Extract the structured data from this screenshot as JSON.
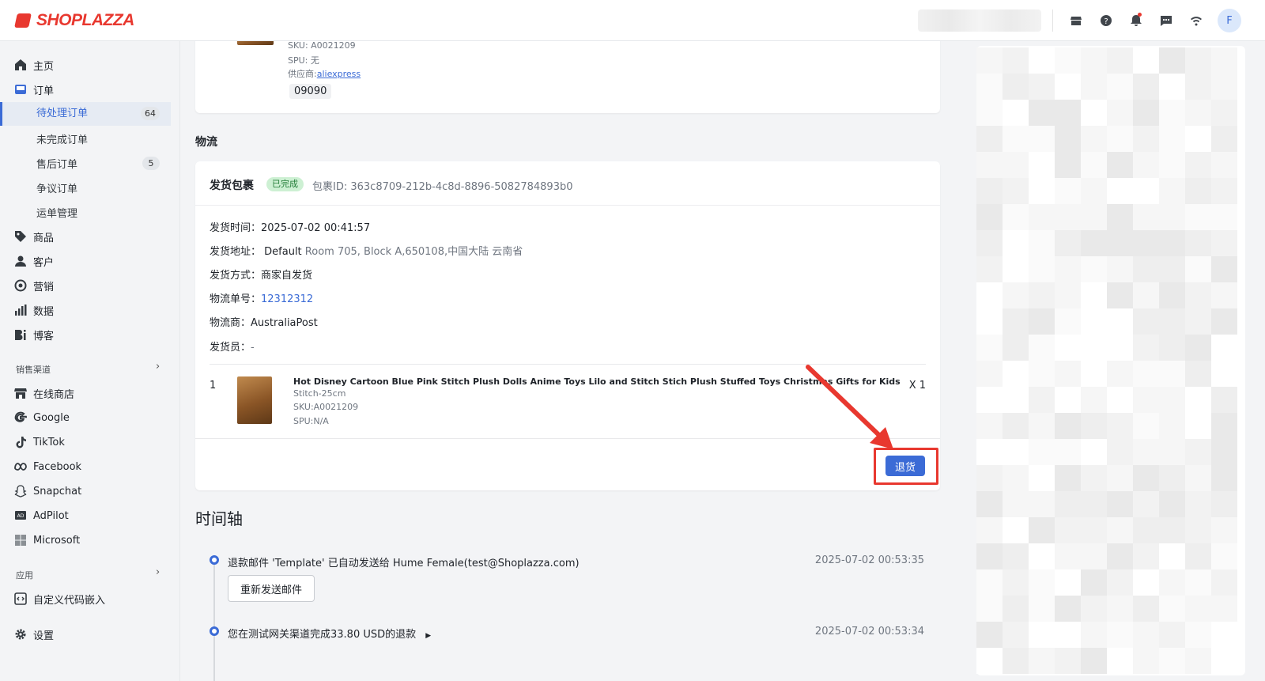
{
  "app": {
    "brand": "SHOPLAZZA",
    "avatar_letter": "F",
    "accent": "#3b6bd6",
    "brand_color": "#e8382f"
  },
  "topbar": {
    "icons": [
      "store-icon",
      "help-icon",
      "bell-icon",
      "chat-icon",
      "wifi-icon"
    ]
  },
  "sidebar": {
    "home": "主页",
    "orders": "订单",
    "orders_sub": [
      {
        "label": "待处理订单",
        "count": "64",
        "active": true
      },
      {
        "label": "未完成订单"
      },
      {
        "label": "售后订单",
        "count": "5"
      },
      {
        "label": "争议订单"
      },
      {
        "label": "运单管理"
      }
    ],
    "products": "商品",
    "customers": "客户",
    "marketing": "营销",
    "analytics": "数据",
    "blog": "博客",
    "channels_title": "销售渠道",
    "channels": [
      "在线商店",
      "Google",
      "TikTok",
      "Facebook",
      "Snapchat",
      "AdPilot",
      "Microsoft"
    ],
    "apps_title": "应用",
    "apps": [
      "自定义代码嵌入"
    ],
    "settings": "设置"
  },
  "top_item": {
    "sku": "SKU: A0021209",
    "spu": "SPU: 无",
    "supplier_label": "供应商:",
    "supplier_link": "aliexpress",
    "tag": "09090"
  },
  "logistics": {
    "section_title": "物流",
    "package_title": "发货包裹",
    "status": "已完成",
    "package_id": "包裹ID: 363c8709-212b-4c8d-8896-5082784893b0",
    "ship_time_label": "发货时间：",
    "ship_time": "2025-07-02 00:41:57",
    "address_label": "发货地址：",
    "address_name": "Default",
    "address": "Room 705, Block A,650108,中国大陆 云南省",
    "method_label": "发货方式：",
    "method": "商家自发货",
    "tracking_label": "物流单号：",
    "tracking": "12312312",
    "carrier_label": "物流商：",
    "carrier": "AustraliaPost",
    "shipper_label": "发货员：",
    "shipper": "-",
    "item_index": "1",
    "item_name": "Hot Disney Cartoon Blue Pink Stitch Plush Dolls Anime Toys Lilo and Stitch Stich Plush Stuffed Toys Christmas Gifts for Kids",
    "item_variant": "Stitch-25cm",
    "item_sku": "SKU:A0021209",
    "item_spu": "SPU:N/A",
    "item_qty": "X 1",
    "return_button": "退货"
  },
  "timeline": {
    "title": "时间轴",
    "events": [
      {
        "text": "退款邮件 'Template' 已自动发送给 Hume Female(test@Shoplazza.com)",
        "time": "2025-07-02 00:53:35",
        "button": "重新发送邮件"
      },
      {
        "text": "您在测试网关渠道完成33.80 USD的退款",
        "time": "2025-07-02 00:53:34"
      }
    ]
  }
}
